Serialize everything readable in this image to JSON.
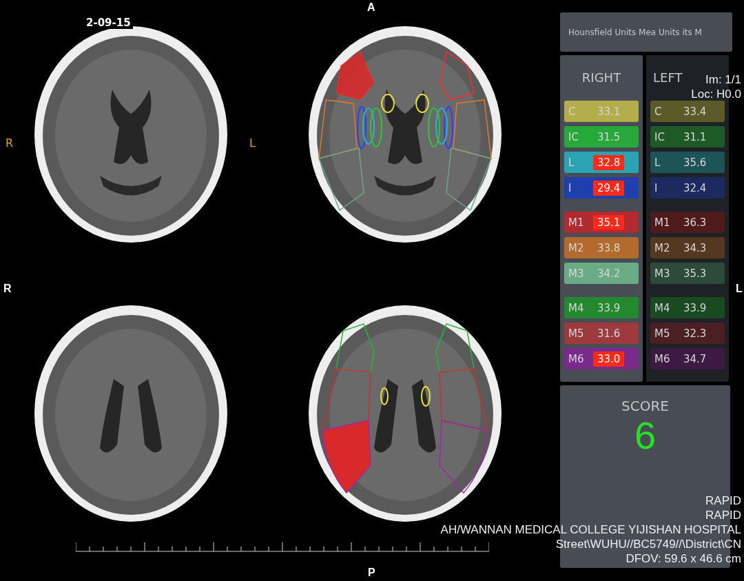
{
  "orientation": {
    "top": "A",
    "left": "R",
    "right": "L",
    "bottom": "P"
  },
  "image_marks": {
    "date": "2-09-15",
    "left": "R",
    "right": "L"
  },
  "images": [
    {
      "kind": "upper"
    },
    {
      "kind": "upper-annotated"
    },
    {
      "kind": "lower"
    },
    {
      "kind": "lower-annotated"
    }
  ],
  "panel": {
    "title": "Hounsfield Units Mea Units its M",
    "columns": [
      {
        "heading": "RIGHT",
        "regions": [
          {
            "label": "C",
            "value": "33.1",
            "color": "#b3ad4c",
            "flagged": false,
            "gap_before": false
          },
          {
            "label": "IC",
            "value": "31.5",
            "color": "#27a83a",
            "flagged": false,
            "gap_before": false
          },
          {
            "label": "L",
            "value": "32.8",
            "color": "#2aa3b4",
            "flagged": true,
            "gap_before": false
          },
          {
            "label": "I",
            "value": "29.4",
            "color": "#1f3fae",
            "flagged": true,
            "gap_before": false
          },
          {
            "label": "M1",
            "value": "35.1",
            "color": "#b02a30",
            "flagged": true,
            "gap_before": true
          },
          {
            "label": "M2",
            "value": "33.8",
            "color": "#b46a2c",
            "flagged": false,
            "gap_before": false
          },
          {
            "label": "M3",
            "value": "34.2",
            "color": "#6aaa84",
            "flagged": false,
            "gap_before": false
          },
          {
            "label": "M4",
            "value": "33.9",
            "color": "#23882e",
            "flagged": false,
            "gap_before": true
          },
          {
            "label": "M5",
            "value": "31.6",
            "color": "#9c3a3e",
            "flagged": false,
            "gap_before": false
          },
          {
            "label": "M6",
            "value": "33.0",
            "color": "#7a2a8a",
            "flagged": true,
            "gap_before": false
          }
        ]
      },
      {
        "heading": "LEFT",
        "regions": [
          {
            "label": "C",
            "value": "33.4",
            "color": "#5d5a2a",
            "flagged": false,
            "gap_before": false
          },
          {
            "label": "IC",
            "value": "31.1",
            "color": "#1d5a26",
            "flagged": false,
            "gap_before": false
          },
          {
            "label": "L",
            "value": "35.6",
            "color": "#1c5458",
            "flagged": false,
            "gap_before": false
          },
          {
            "label": "I",
            "value": "32.4",
            "color": "#1c2a60",
            "flagged": false,
            "gap_before": false
          },
          {
            "label": "M1",
            "value": "36.3",
            "color": "#4e1a1c",
            "flagged": false,
            "gap_before": true
          },
          {
            "label": "M2",
            "value": "34.3",
            "color": "#553820",
            "flagged": false,
            "gap_before": false
          },
          {
            "label": "M3",
            "value": "35.3",
            "color": "#2e4a3a",
            "flagged": false,
            "gap_before": false
          },
          {
            "label": "M4",
            "value": "33.9",
            "color": "#1a4a22",
            "flagged": false,
            "gap_before": true
          },
          {
            "label": "M5",
            "value": "32.3",
            "color": "#4a2024",
            "flagged": false,
            "gap_before": false
          },
          {
            "label": "M6",
            "value": "34.7",
            "color": "#3c1a44",
            "flagged": false,
            "gap_before": false
          }
        ]
      }
    ],
    "score": {
      "label": "SCORE",
      "value": "6"
    }
  },
  "overlay": {
    "image_number": "Im: 1/1",
    "location": "Loc: H0.0",
    "lines": [
      "RAPID",
      "RAPID",
      "AH/WANNAN MEDICAL COLLEGE YIJISHAN HOSPITAL",
      "Street\\WUHU//BC5749//\\District\\CN",
      "DFOV: 59.6 x 46.6 cm"
    ]
  }
}
